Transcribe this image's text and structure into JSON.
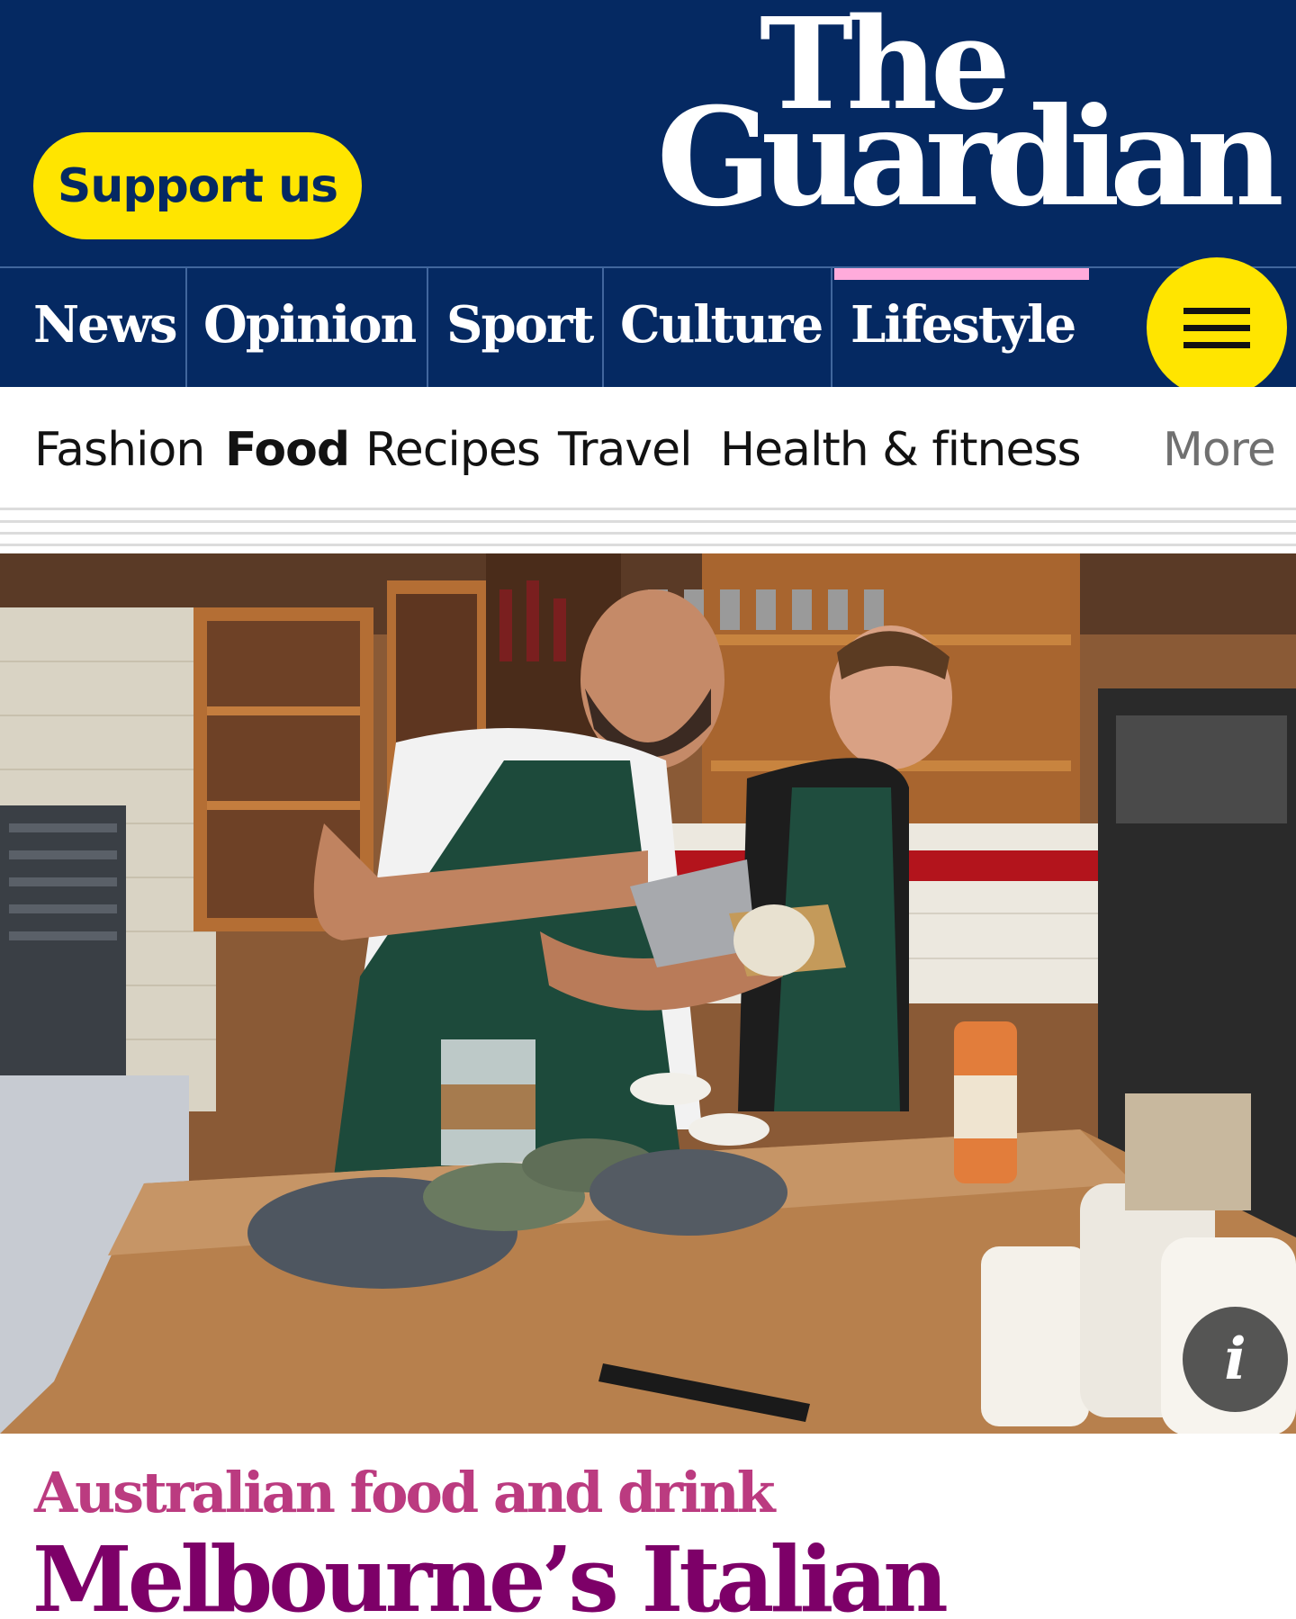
{
  "header": {
    "support_label": "Support us",
    "logo_line1": "The",
    "logo_line2": "Guardian"
  },
  "pillars": [
    {
      "label": "News"
    },
    {
      "label": "Opinion"
    },
    {
      "label": "Sport"
    },
    {
      "label": "Culture"
    },
    {
      "label": "Lifestyle",
      "active": true
    }
  ],
  "subnav": [
    {
      "label": "Fashion"
    },
    {
      "label": "Food",
      "active": true
    },
    {
      "label": "Recipes"
    },
    {
      "label": "Travel"
    },
    {
      "label": "Health & fitness"
    }
  ],
  "subnav_more": "More",
  "article": {
    "kicker": "Australian food and drink",
    "headline": "Melbourne’s Italian",
    "info_icon": "i"
  },
  "colors": {
    "brand": "#052962",
    "support": "#ffe500",
    "lifestyle_accent": "#ffabdb",
    "kicker": "#bb3b80",
    "headline": "#7d0068"
  }
}
